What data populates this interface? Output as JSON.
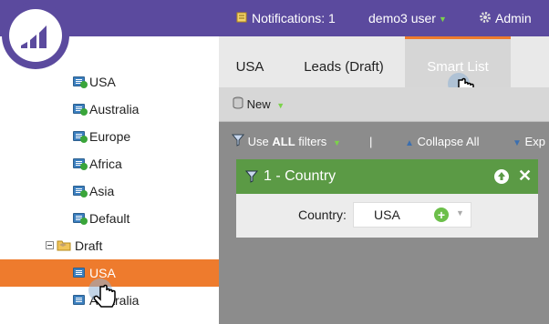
{
  "topbar": {
    "notifications": "Notifications: 1",
    "user": "demo3 user",
    "admin": "Admin"
  },
  "tree": {
    "items": [
      {
        "label": "USA"
      },
      {
        "label": "Australia"
      },
      {
        "label": "Europe"
      },
      {
        "label": "Africa"
      },
      {
        "label": "Asia"
      },
      {
        "label": "Default"
      }
    ],
    "folder": "Draft",
    "draft_items": [
      {
        "label": "USA"
      },
      {
        "label": "Australia"
      }
    ]
  },
  "tabs": [
    {
      "label": "USA"
    },
    {
      "label": "Leads (Draft)"
    },
    {
      "label": "Smart List"
    }
  ],
  "toolbar": {
    "new_label": "New"
  },
  "filters_bar": {
    "use_prefix": "Use ",
    "use_bold": "ALL",
    "use_suffix": " filters",
    "separator": "|",
    "collapse": "Collapse All",
    "expand": "Exp"
  },
  "filter": {
    "title": "1 - Country",
    "field_label": "Country:",
    "field_value": "USA"
  },
  "cursor_badge": "2",
  "colors": {
    "topbar": "#5b4a9e",
    "selected": "#ee7b2d",
    "filter_header": "#5b9a45"
  }
}
